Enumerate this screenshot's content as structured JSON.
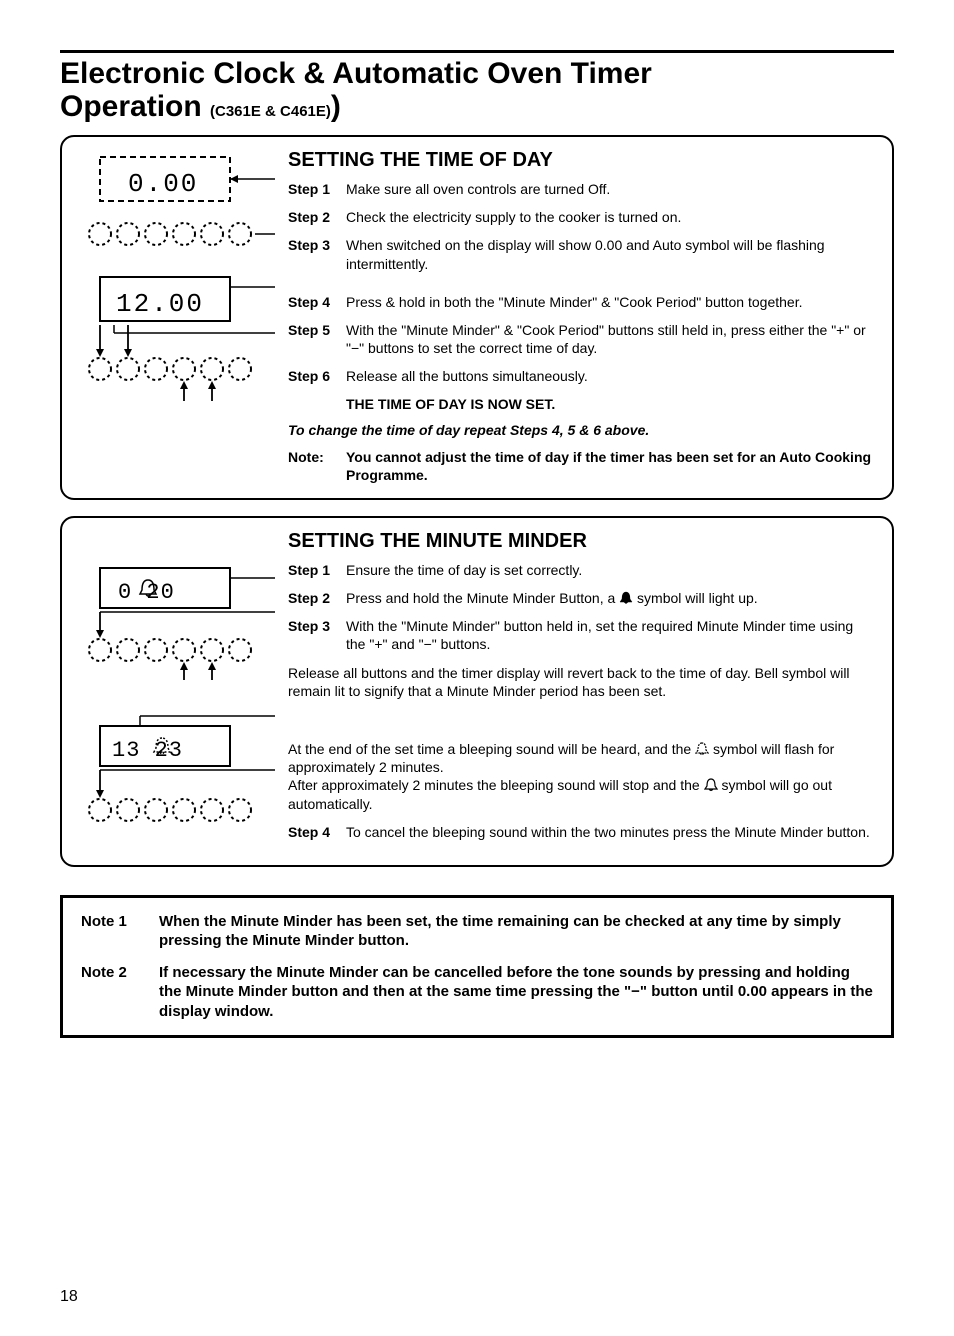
{
  "title_line1": "Electronic Clock & Automatic Oven Timer",
  "title_line2_main": "Operation ",
  "title_line2_suffix": "(C361E & C461E)",
  "title_paren_close": ")",
  "section1": {
    "heading": "SETTING THE TIME OF DAY",
    "display1": "0.00",
    "display2": "12.00",
    "steps": {
      "s1_label": "Step 1",
      "s1_text": "Make sure all oven controls are turned Off.",
      "s2_label": "Step 2",
      "s2_text": "Check the electricity supply to the cooker is turned on.",
      "s3_label": "Step 3",
      "s3_text": "When switched on the display will show 0.00 and Auto symbol will be flashing intermittently.",
      "s4_label": "Step 4",
      "s4_text": "Press & hold in both the \"Minute Minder\" & \"Cook Period\" button together.",
      "s5_label": "Step 5",
      "s5_text": "With the \"Minute Minder\" & \"Cook Period\" buttons still held in, press either the \"+\" or \"−\" buttons to set the correct time of day.",
      "s6_label": "Step 6",
      "s6_text": "Release all the buttons simultaneously."
    },
    "now_set": "THE TIME OF DAY IS NOW SET.",
    "italic": "To change the time of day repeat Steps 4, 5 & 6 above.",
    "note_label": "Note:",
    "note_text": "You cannot adjust the time of day if the timer has been set for an Auto Cooking Programme."
  },
  "section2": {
    "heading": "SETTING THE MINUTE MINDER",
    "display1": "0 20",
    "display2": "13 23",
    "steps": {
      "s1_label": "Step 1",
      "s1_text": "Ensure the time of day is set correctly.",
      "s2_label": "Step 2",
      "s2_text_a": "Press and hold the Minute Minder Button, a ",
      "s2_text_b": " symbol will light up.",
      "s3_label": "Step 3",
      "s3_text": "With the \"Minute Minder\" button held in, set the required Minute Minder time using the \"+\" and \"−\" buttons."
    },
    "para1": "Release all buttons and the timer display will revert back to the time of day. Bell symbol will remain lit to signify that a Minute Minder period has been set.",
    "para2_a": "At the end of the set time a bleeping sound will be heard, and the ",
    "para2_b": " symbol will flash for approximately 2 minutes.",
    "para2_c": "After approximately 2 minutes the bleeping sound will stop and the ",
    "para2_d": " symbol will go out automatically.",
    "s4_label": "Step 4",
    "s4_text": "To cancel the bleeping sound within the two minutes press the Minute Minder button."
  },
  "bottom": {
    "n1_label": "Note 1",
    "n1_text": "When the Minute Minder has been set, the time remaining can be checked at any time by simply pressing the Minute Minder button.",
    "n2_label": "Note 2",
    "n2_text": "If necessary the Minute Minder can be cancelled before the tone sounds by pressing and holding the Minute Minder button and then at the same time pressing the \"−\" button until 0.00 appears in the display window."
  },
  "page_number": "18"
}
